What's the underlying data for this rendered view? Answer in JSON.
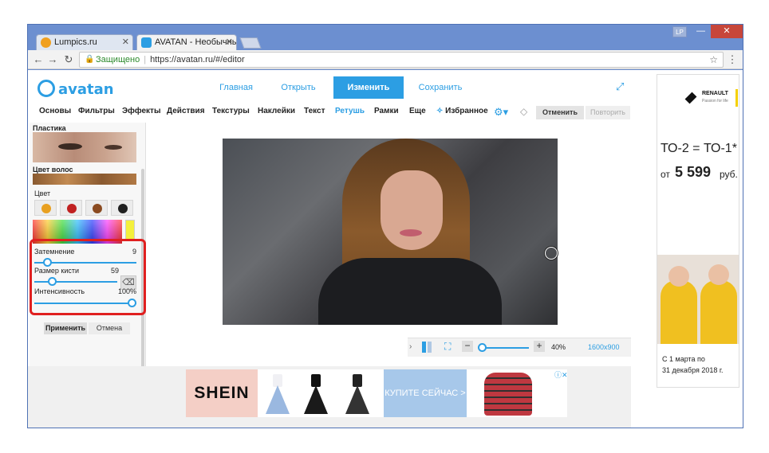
{
  "browser": {
    "tabs": [
      {
        "label": "Lumpics.ru",
        "favicon_color": "#f0a020",
        "active": false
      },
      {
        "label": "AVATAN - Необычный (",
        "favicon_color": "#2c9ee3",
        "active": true
      }
    ],
    "profile_badge": "LP",
    "address": {
      "secure_label": "Защищено",
      "url": "https://avatan.ru/#/editor"
    }
  },
  "app": {
    "logo_text": "avatan",
    "main_nav": {
      "home": "Главная",
      "open": "Открыть",
      "edit": "Изменить",
      "save": "Сохранить"
    },
    "tools": [
      "Основы",
      "Фильтры",
      "Эффекты",
      "Действия",
      "Текстуры",
      "Наклейки",
      "Текст",
      "Ретушь",
      "Рамки",
      "Еще",
      "Избранное"
    ],
    "active_tool": "Ретушь",
    "undo_label": "Отменить",
    "redo_label": "Повторить"
  },
  "panel": {
    "plastic_title": "Пластика",
    "hair_title": "Цвет волос",
    "color_label": "Цвет",
    "swatches": [
      "#e8a020",
      "#c02020",
      "#8a4a20",
      "#202020"
    ],
    "picked_color": "#f4f03c",
    "sliders": [
      {
        "label": "Затемнение",
        "value": "9",
        "fraction": 0.09
      },
      {
        "label": "Размер кисти",
        "value": "59",
        "fraction": 0.18
      },
      {
        "label": "Интенсивность",
        "value": "100%",
        "fraction": 1.0
      }
    ],
    "apply_label": "Применить",
    "cancel_label": "Отмена"
  },
  "canvas": {
    "zoom_label": "40%",
    "size_label": "1600x900"
  },
  "banner_ad": {
    "brand": "SHEIN",
    "cta": "КУПИТЕ СЕЙЧАС >"
  },
  "side_ad": {
    "brand": "RENAULT",
    "tagline": "Passion for life",
    "model": "ТО-2 = ТО-1*",
    "price_prefix": "от",
    "price": "5 599",
    "price_currency": "руб.",
    "date_line1": "С 1 марта по",
    "date_line2": "31 декабря 2018 г."
  },
  "colors": {
    "accent": "#2c9ee3",
    "highlight": "#e02020"
  }
}
